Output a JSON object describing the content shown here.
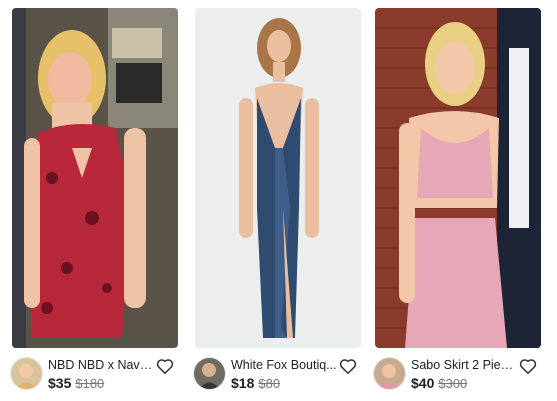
{
  "listings": [
    {
      "title": "NBD NBD x Nave...",
      "price": "$35",
      "original_price": "$180",
      "photo_icon": "red-snakeskin-dress-photo",
      "like_icon": "heart-outline-icon"
    },
    {
      "title": "White Fox Boutiq...",
      "price": "$18",
      "original_price": "$80",
      "photo_icon": "navy-satin-gown-photo",
      "like_icon": "heart-outline-icon"
    },
    {
      "title": "Sabo Skirt 2 Piec...",
      "price": "$40",
      "original_price": "$300",
      "photo_icon": "pink-two-piece-set-photo",
      "like_icon": "heart-outline-icon"
    }
  ],
  "colors": {
    "text": "#222222",
    "muted": "#777777",
    "heart": "#333333"
  }
}
